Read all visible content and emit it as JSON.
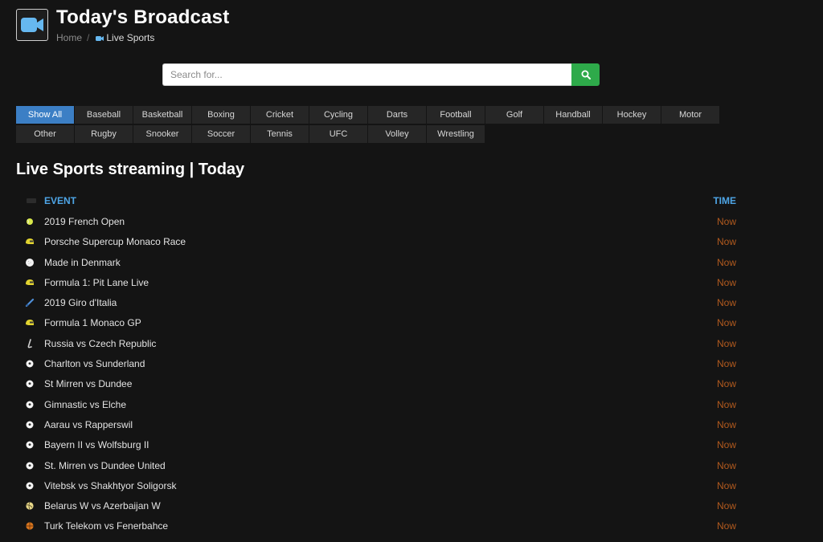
{
  "header": {
    "title": "Today's Broadcast",
    "breadcrumb": {
      "home": "Home",
      "separator": "/",
      "current": "Live Sports"
    }
  },
  "search": {
    "placeholder": "Search for...",
    "value": "",
    "button_icon": "search-icon"
  },
  "filters": {
    "active": "Show All",
    "row1": [
      "Show All",
      "Baseball",
      "Basketball",
      "Boxing",
      "Cricket",
      "Cycling",
      "Darts",
      "Football",
      "Golf",
      "Handball",
      "Hockey",
      "Motor"
    ],
    "row2": [
      "Other",
      "Rugby",
      "Snooker",
      "Soccer",
      "Tennis",
      "UFC",
      "Volley",
      "Wrestling"
    ]
  },
  "section_title": "Live Sports streaming | Today",
  "table": {
    "col_event": "EVENT",
    "col_time": "TIME",
    "rows": [
      {
        "event": "2019 French Open",
        "time": "Now",
        "icon": "tennis-ball-icon"
      },
      {
        "event": "Porsche Supercup Monaco Race",
        "time": "Now",
        "icon": "helmet-icon"
      },
      {
        "event": "Made in Denmark",
        "time": "Now",
        "icon": "golf-ball-icon"
      },
      {
        "event": "Formula 1: Pit Lane Live",
        "time": "Now",
        "icon": "helmet-icon"
      },
      {
        "event": "2019 Giro d'Italia",
        "time": "Now",
        "icon": "cycling-icon"
      },
      {
        "event": "Formula 1 Monaco GP",
        "time": "Now",
        "icon": "helmet-icon"
      },
      {
        "event": "Russia vs Czech Republic",
        "time": "Now",
        "icon": "hockey-stick-icon"
      },
      {
        "event": "Charlton vs Sunderland",
        "time": "Now",
        "icon": "soccer-ball-icon"
      },
      {
        "event": "St Mirren vs Dundee",
        "time": "Now",
        "icon": "soccer-ball-icon"
      },
      {
        "event": "Gimnastic vs Elche",
        "time": "Now",
        "icon": "soccer-ball-icon"
      },
      {
        "event": "Aarau vs Rapperswil",
        "time": "Now",
        "icon": "soccer-ball-icon"
      },
      {
        "event": "Bayern II vs Wolfsburg II",
        "time": "Now",
        "icon": "soccer-ball-icon"
      },
      {
        "event": "St. Mirren vs Dundee United",
        "time": "Now",
        "icon": "soccer-ball-icon"
      },
      {
        "event": "Vitebsk vs Shakhtyor Soligorsk",
        "time": "Now",
        "icon": "soccer-ball-icon"
      },
      {
        "event": "Belarus W vs Azerbaijan W",
        "time": "Now",
        "icon": "volleyball-icon"
      },
      {
        "event": "Turk Telekom vs Fenerbahce",
        "time": "Now",
        "icon": "basketball-icon"
      }
    ]
  },
  "colors": {
    "background": "#141414",
    "accent_blue": "#4ea5e6",
    "active_filter": "#3c7fc5",
    "search_button": "#2eaa4a",
    "time_text": "#b25a1e"
  }
}
